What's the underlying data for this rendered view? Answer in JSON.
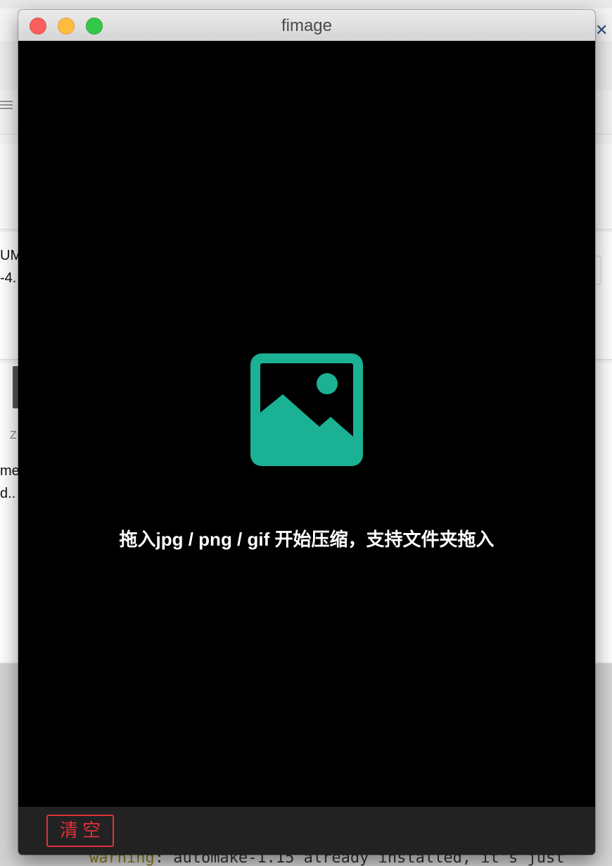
{
  "background": {
    "partial_text_lines": [
      "UM",
      "-4.",
      "me",
      "d.."
    ],
    "zip_label": "Z",
    "terminal": {
      "warning_word": "warning",
      "rest": ": automake-1.15 already installed, it's just"
    }
  },
  "window": {
    "title": "fimage"
  },
  "drop_zone": {
    "icon": "image-icon",
    "hint": "拖入jpg / png / gif 开始压缩，支持文件夹拖入",
    "icon_color": "#1bb194"
  },
  "toolbar": {
    "clear_label": "清空",
    "clear_color": "#e0323a"
  }
}
